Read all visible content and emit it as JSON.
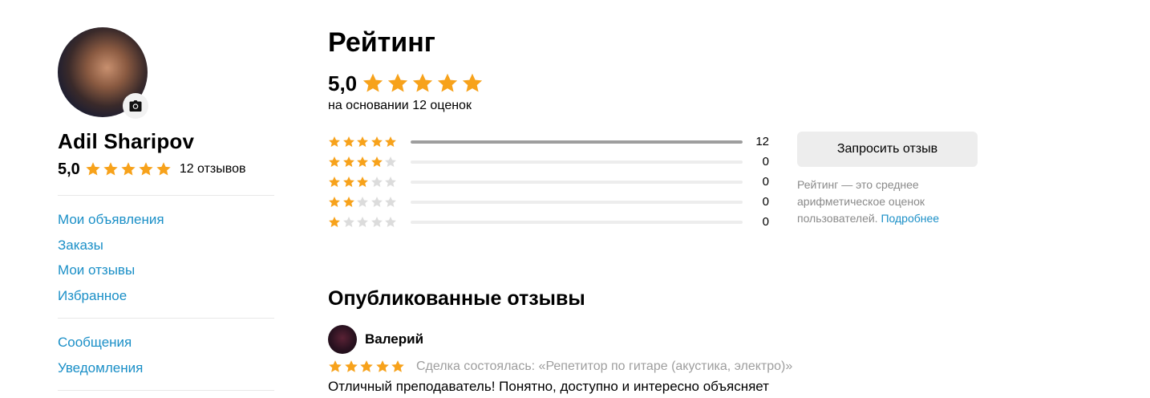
{
  "profile": {
    "name": "Adil Sharipov",
    "rating": "5,0",
    "rating_stars": 5,
    "review_count": "12 отзывов"
  },
  "sidebar": {
    "group1": [
      {
        "label": "Мои объявления"
      },
      {
        "label": "Заказы"
      },
      {
        "label": "Мои отзывы"
      },
      {
        "label": "Избранное"
      }
    ],
    "group2": [
      {
        "label": "Сообщения"
      },
      {
        "label": "Уведомления"
      }
    ]
  },
  "rating_section": {
    "title": "Рейтинг",
    "score": "5,0",
    "score_stars": 5,
    "based_on": "на основании 12 оценок",
    "breakdown": [
      {
        "stars": 5,
        "count": "12",
        "fraction": 1.0
      },
      {
        "stars": 4,
        "count": "0",
        "fraction": 0
      },
      {
        "stars": 3,
        "count": "0",
        "fraction": 0
      },
      {
        "stars": 2,
        "count": "0",
        "fraction": 0
      },
      {
        "stars": 1,
        "count": "0",
        "fraction": 0
      }
    ],
    "request_button": "Запросить отзыв",
    "note": "Рейтинг — это среднее арифметическое оценок пользователей.",
    "note_link": "Подробнее"
  },
  "reviews_section": {
    "title": "Опубликованные отзывы",
    "reviews": [
      {
        "author": "Валерий",
        "stars": 5,
        "deal": "Сделка состоялась: «Репетитор по гитаре (акустика, электро)»",
        "text": "Отличный преподаватель! Понятно, доступно и интересно объясняет"
      }
    ]
  },
  "colors": {
    "star": "#f7a21b",
    "star_empty": "#dcdcdc",
    "link": "#1a8fc7",
    "bar_fill": "#9e9e9e",
    "bar_bg": "#ededed",
    "muted_text": "#8a8a8a"
  },
  "icons": {
    "camera": "camera-icon",
    "star": "star-icon"
  }
}
